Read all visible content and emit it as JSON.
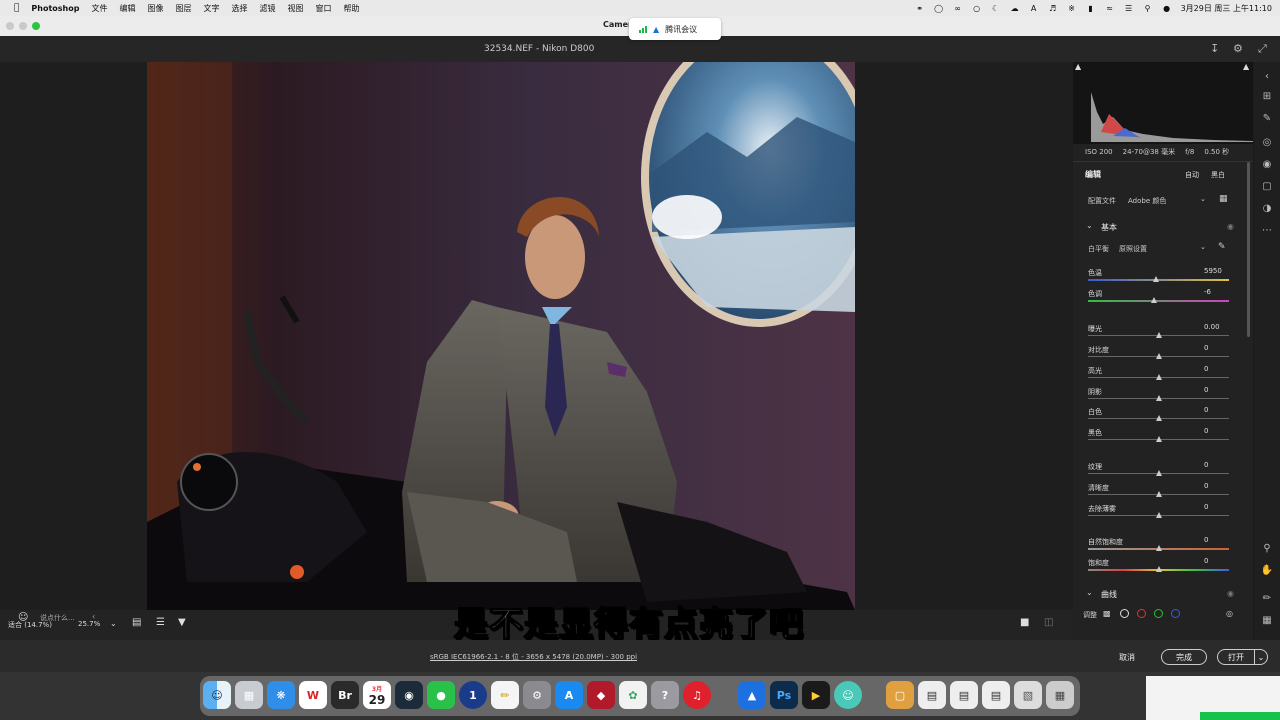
{
  "menubar": {
    "app": "Photoshop",
    "items": [
      "文件",
      "编辑",
      "图像",
      "图层",
      "文字",
      "选择",
      "滤镜",
      "视图",
      "窗口",
      "帮助"
    ],
    "datetime": "3月29日 周三 上午11:10"
  },
  "window": {
    "title": "Camer",
    "filename": "32534.NEF - Nikon D800"
  },
  "meeting_popup": {
    "label": "腾讯会议"
  },
  "camera_info": {
    "iso": "ISO 200",
    "lens": "24-70@38 毫米",
    "aperture": "f/8",
    "shutter": "0.50 秒"
  },
  "panel": {
    "edit_label": "编辑",
    "auto_label": "自动",
    "bw_label": "黑白",
    "profile_label": "配置文件",
    "profile_value": "Adobe 颜色",
    "basic_section": "基本",
    "wb_label": "白平衡",
    "wb_value": "原照设置",
    "sliders": [
      {
        "label": "色温",
        "value": "5950",
        "pos": 0.48
      },
      {
        "label": "色调",
        "value": "-6",
        "pos": 0.47
      },
      {
        "label": "曝光",
        "value": "0.00",
        "pos": 0.5
      },
      {
        "label": "对比度",
        "value": "0",
        "pos": 0.5
      },
      {
        "label": "高光",
        "value": "0",
        "pos": 0.5
      },
      {
        "label": "阴影",
        "value": "0",
        "pos": 0.5
      },
      {
        "label": "白色",
        "value": "0",
        "pos": 0.5
      },
      {
        "label": "黑色",
        "value": "0",
        "pos": 0.5
      },
      {
        "label": "纹理",
        "value": "0",
        "pos": 0.5
      },
      {
        "label": "清晰度",
        "value": "0",
        "pos": 0.5
      },
      {
        "label": "去除薄雾",
        "value": "0",
        "pos": 0.5
      },
      {
        "label": "自然饱和度",
        "value": "0",
        "pos": 0.5
      },
      {
        "label": "饱和度",
        "value": "0",
        "pos": 0.5
      }
    ],
    "curve_section": "曲线",
    "adjust_label": "调整"
  },
  "bottom": {
    "comment_placeholder": "说点什么...",
    "zoom": "适合 (14.7%)",
    "zoom2": "25.7%"
  },
  "status": {
    "info_link": "sRGB IEC61966-2.1 - 8 位 - 3656 x 5478 (20.0MP) - 300 ppi",
    "cancel": "取消",
    "done": "完成",
    "open": "打开"
  },
  "subtitle": "是不是显得有点亮了吧",
  "dock": {
    "calendar_month": "3月",
    "calendar_day": "29",
    "items": [
      "finder",
      "launchpad",
      "safari",
      "wps",
      "bridge",
      "calendar",
      "capture",
      "wechat",
      "1password",
      "pencil",
      "settings",
      "appstore",
      "photo-booth",
      "pixelmator",
      "help",
      "netease",
      "tencent-meeting",
      "photoshop",
      "final-cut",
      "wechat-work",
      "box",
      "doc1",
      "doc2",
      "doc3",
      "trash"
    ]
  }
}
